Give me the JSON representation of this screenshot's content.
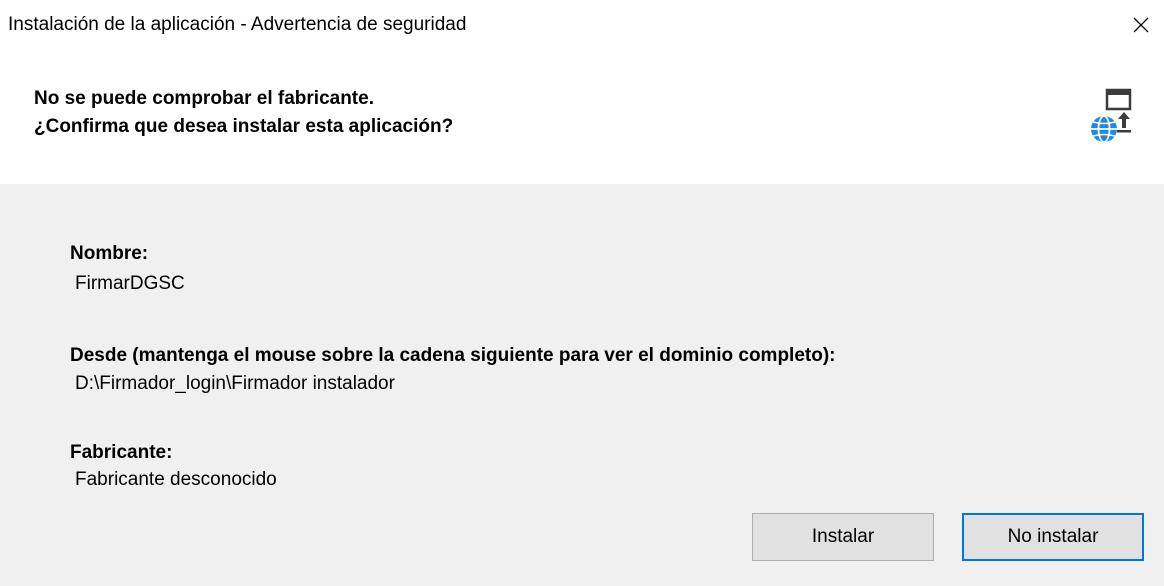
{
  "window": {
    "title": "Instalación de la aplicación - Advertencia de seguridad"
  },
  "header": {
    "line1": "No se puede comprobar el fabricante.",
    "line2": "¿Confirma que desea instalar esta aplicación?",
    "icon": "application-install-icon"
  },
  "details": {
    "name_label": "Nombre:",
    "name_value": "FirmarDGSC",
    "from_label": "Desde (mantenga el mouse sobre la cadena siguiente para ver el dominio completo):",
    "from_value": "D:\\Firmador_login\\Firmador instalador",
    "publisher_label": "Fabricante:",
    "publisher_value": "Fabricante desconocido"
  },
  "buttons": {
    "install": "Instalar",
    "dont_install": "No instalar"
  },
  "colors": {
    "body_background": "#f0f0f0",
    "focus_border": "#0078d7",
    "globe_blue": "#1e88e5"
  }
}
